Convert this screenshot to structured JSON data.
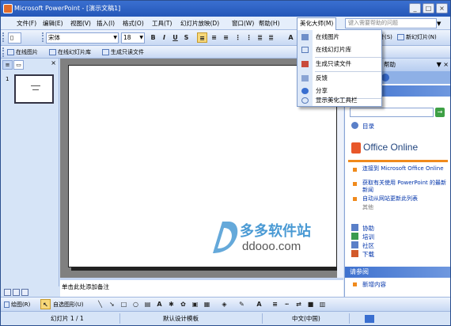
{
  "window": {
    "title": "Microsoft PowerPoint - [演示文稿1]"
  },
  "menubar": {
    "items": [
      "文件(F)",
      "编辑(E)",
      "视图(V)",
      "插入(I)",
      "格式(O)",
      "工具(T)",
      "幻灯片放映(D)",
      "窗口(W)",
      "帮助(H)",
      "美化大师(M)"
    ],
    "help_placeholder": "键入需要帮助的问题"
  },
  "format_toolbar": {
    "font": "宋体",
    "size": "18",
    "new_slide": "新幻灯片(N)",
    "design_cut": "计(S)"
  },
  "addin_toolbar": {
    "online_pic": "在线图片",
    "online_lib": "在线幻灯片库",
    "readonly": "生成只读文件"
  },
  "dropdown": {
    "items": [
      "在线图片",
      "在线幻灯片库",
      "生成只读文件",
      "反馈",
      "分享",
      "显示美化工具栏"
    ]
  },
  "outline": {
    "slide_num": "1"
  },
  "notes": {
    "placeholder": "单击此处添加备注"
  },
  "taskpane": {
    "header": "帮助",
    "toc": "目录",
    "office_online": "Office Online",
    "links": [
      "连接到 Microsoft Office Online",
      "获取有关使用 PowerPoint 的最新新闻",
      "自动从网站更新此列表"
    ],
    "more": "其他",
    "bottom_links": [
      "协助",
      "培训",
      "社区",
      "下载"
    ],
    "see_also": "请参阅",
    "new_content": "新增内容"
  },
  "drawbar": {
    "draw": "绘图(R)",
    "autoshape": "自选图形(U)"
  },
  "statusbar": {
    "slide": "幻灯片 1 / 1",
    "template": "默认设计模板",
    "lang": "中文(中国)"
  },
  "watermark": {
    "name": "多多软件站",
    "url": "ddooo.com"
  },
  "colors": {
    "accent": "#3a6fd0",
    "highlight": "#f7d87a",
    "orange": "#f08a1c"
  }
}
